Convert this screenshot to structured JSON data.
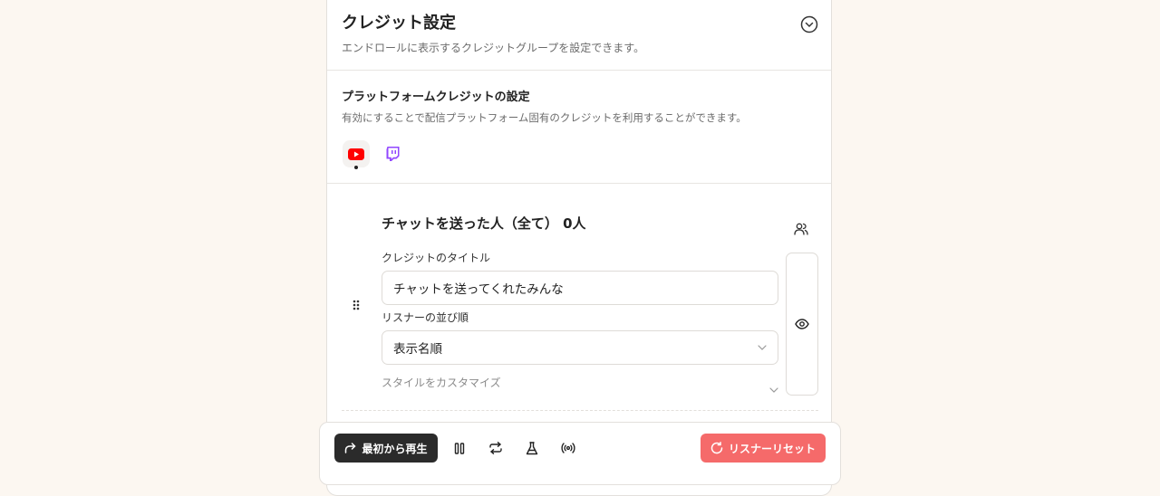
{
  "header": {
    "title": "クレジット設定",
    "subtitle": "エンドロールに表示するクレジットグループを設定できます。"
  },
  "platform": {
    "title": "プラットフォームクレジットの設定",
    "subtitle": "有効にすることで配信プラットフォーム固有のクレジットを利用することができます。",
    "items": [
      {
        "icon": "youtube-icon",
        "color": "#ff0000",
        "selected": true
      },
      {
        "icon": "twitch-icon",
        "color": "#9146ff",
        "selected": false
      }
    ]
  },
  "group": {
    "title": "チャットを送った人（全て） 0人",
    "credit_title_label": "クレジットのタイトル",
    "credit_title_value": "チャットを送ってくれたみんな",
    "order_label": "リスナーの並び順",
    "order_value": "表示名順",
    "customize_label": "スタイルをカスタマイズ"
  },
  "toolbar": {
    "play_label": "最初から再生",
    "reset_label": "リスナーリセット",
    "reset_color": "#f56a6a"
  }
}
